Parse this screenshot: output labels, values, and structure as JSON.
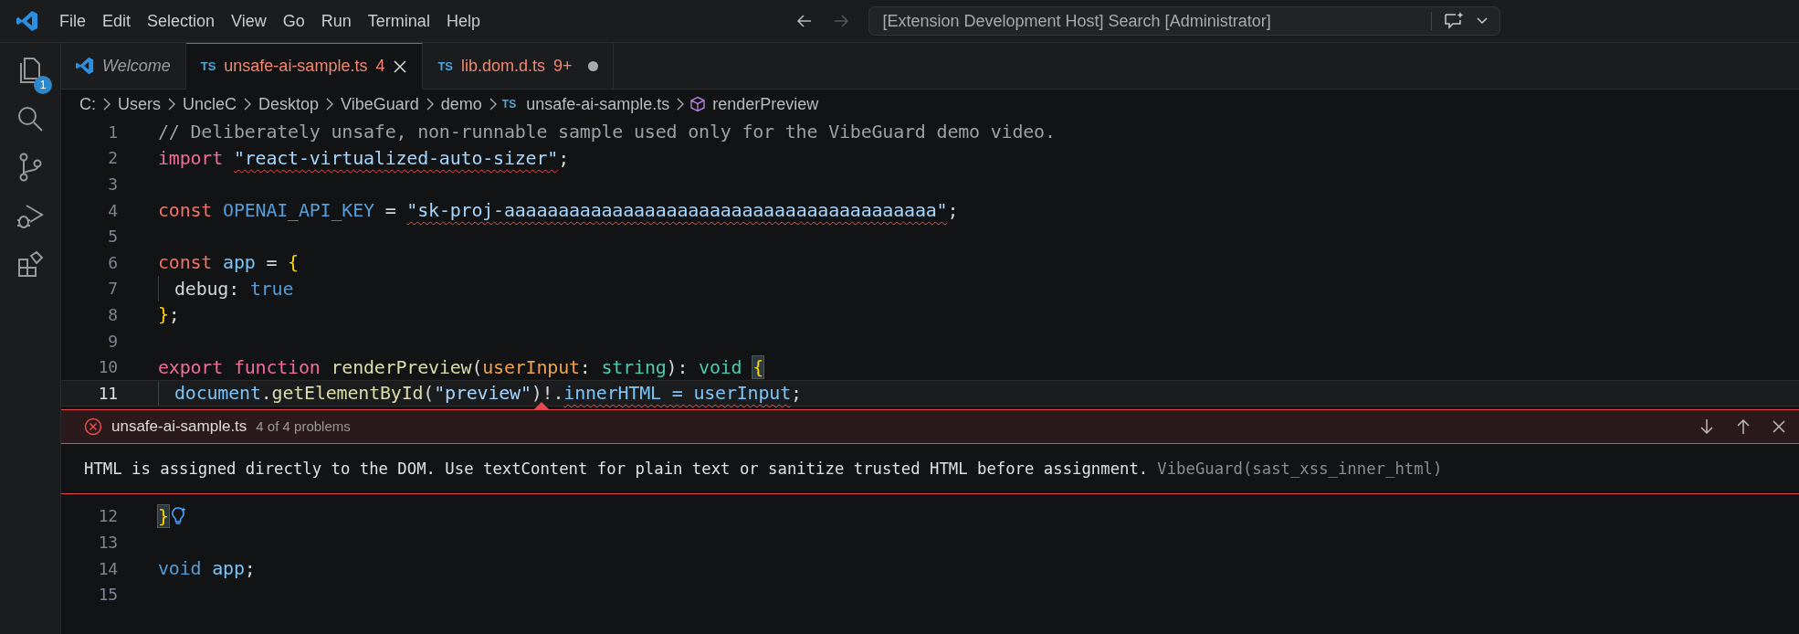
{
  "menu": [
    "File",
    "Edit",
    "Selection",
    "View",
    "Go",
    "Run",
    "Terminal",
    "Help"
  ],
  "nav": {
    "back_disabled": false,
    "forward_disabled": true
  },
  "command_center": {
    "text": "[Extension Development Host] Search [Administrator]"
  },
  "activity_bar": [
    {
      "kind": "files",
      "badge": "1"
    },
    {
      "kind": "search"
    },
    {
      "kind": "source-control"
    },
    {
      "kind": "debug"
    },
    {
      "kind": "extensions"
    }
  ],
  "tabs": [
    {
      "kind": "welcome",
      "label": "Welcome",
      "preview": true,
      "selected": false,
      "has_errors": false,
      "dirty": false
    },
    {
      "kind": "ts",
      "icon_text": "TS",
      "label": "unsafe-ai-sample.ts",
      "preview": false,
      "selected": true,
      "has_errors": true,
      "problems": "4",
      "dirty": false
    },
    {
      "kind": "ts",
      "icon_text": "TS",
      "label": "lib.dom.d.ts",
      "preview": false,
      "selected": false,
      "has_errors": true,
      "problems": "9+",
      "dirty": true
    }
  ],
  "breadcrumbs": [
    {
      "kind": "folder",
      "text": "C:"
    },
    {
      "kind": "folder",
      "text": "Users"
    },
    {
      "kind": "folder",
      "text": "UncleC"
    },
    {
      "kind": "folder",
      "text": "Desktop"
    },
    {
      "kind": "folder",
      "text": "VibeGuard"
    },
    {
      "kind": "folder",
      "text": "demo"
    },
    {
      "kind": "file",
      "icon_text": "TS",
      "text": "unsafe-ai-sample.ts"
    },
    {
      "kind": "symbol",
      "text": "renderPreview"
    }
  ],
  "code_top": [
    {
      "number": "1",
      "current": false,
      "tokens": [
        {
          "text": "// Deliberately unsafe, non-runnable sample used only for the VibeGuard demo video.",
          "kind": "comment"
        }
      ]
    },
    {
      "number": "2",
      "current": false,
      "tokens": [
        {
          "text": "import ",
          "kind": "control"
        },
        {
          "text": "\"react-virtualized-auto-sizer\"",
          "kind": "string",
          "error": true
        },
        {
          "text": ";",
          "kind": "plain"
        }
      ]
    },
    {
      "number": "3",
      "current": false
    },
    {
      "number": "4",
      "current": false,
      "tokens": [
        {
          "text": "const ",
          "kind": "keyword"
        },
        {
          "text": "OPENAI_API_KEY",
          "kind": "constant"
        },
        {
          "text": " = ",
          "kind": "plain"
        },
        {
          "text": "\"sk-proj-aaaaaaaaaaaaaaaaaaaaaaaaaaaaaaaaaaaaaaaa\"",
          "kind": "string",
          "error": true
        },
        {
          "text": ";",
          "kind": "plain"
        }
      ]
    },
    {
      "number": "5",
      "current": false
    },
    {
      "number": "6",
      "current": false,
      "tokens": [
        {
          "text": "const ",
          "kind": "keyword"
        },
        {
          "text": "app",
          "kind": "variable"
        },
        {
          "text": " = ",
          "kind": "plain"
        },
        {
          "text": "{",
          "kind": "bracket"
        }
      ]
    },
    {
      "number": "7",
      "current": false,
      "indent": true,
      "tokens": [
        {
          "text": "debug",
          "kind": "property"
        },
        {
          "text": ": ",
          "kind": "plain"
        },
        {
          "text": "true",
          "kind": "boolean"
        }
      ]
    },
    {
      "number": "8",
      "current": false,
      "tokens": [
        {
          "text": "}",
          "kind": "bracket"
        },
        {
          "text": ";",
          "kind": "plain"
        }
      ]
    },
    {
      "number": "9",
      "current": false
    },
    {
      "number": "10",
      "current": false,
      "tokens": [
        {
          "text": "export ",
          "kind": "control"
        },
        {
          "text": "function ",
          "kind": "control"
        },
        {
          "text": "renderPreview",
          "kind": "function"
        },
        {
          "text": "(",
          "kind": "plain"
        },
        {
          "text": "userInput",
          "kind": "param"
        },
        {
          "text": ": ",
          "kind": "plain"
        },
        {
          "text": "string",
          "kind": "type"
        },
        {
          "text": "): ",
          "kind": "plain"
        },
        {
          "text": "void ",
          "kind": "type"
        },
        {
          "text": "{",
          "kind": "bracket-match"
        }
      ]
    },
    {
      "number": "11",
      "current": true,
      "indent": true,
      "tokens": [
        {
          "text": "document",
          "kind": "variable"
        },
        {
          "text": ".",
          "kind": "plain"
        },
        {
          "text": "getElementById",
          "kind": "function"
        },
        {
          "text": "(",
          "kind": "plain"
        },
        {
          "text": "\"preview\"",
          "kind": "string"
        },
        {
          "text": ")!.",
          "kind": "plain"
        },
        {
          "text": "innerHTML = userInput",
          "kind": "variable",
          "error": true
        },
        {
          "text": ";",
          "kind": "plain"
        }
      ]
    }
  ],
  "peek": {
    "file": "unsafe-ai-sample.ts",
    "count": "4 of 4 problems",
    "message": "HTML is assigned directly to the DOM. Use textContent for plain text or sanitize trusted HTML before assignment.",
    "source": "VibeGuard(sast_xss_inner_html)"
  },
  "code_bottom": [
    {
      "number": "12",
      "current": false,
      "lightbulb": true,
      "tokens": [
        {
          "text": "}",
          "kind": "bracket-match"
        }
      ]
    },
    {
      "number": "13",
      "current": false
    },
    {
      "number": "14",
      "current": false,
      "tokens": [
        {
          "text": "void ",
          "kind": "storage"
        },
        {
          "text": "app",
          "kind": "variable"
        },
        {
          "text": ";",
          "kind": "plain"
        }
      ]
    },
    {
      "number": "15",
      "current": false
    }
  ]
}
